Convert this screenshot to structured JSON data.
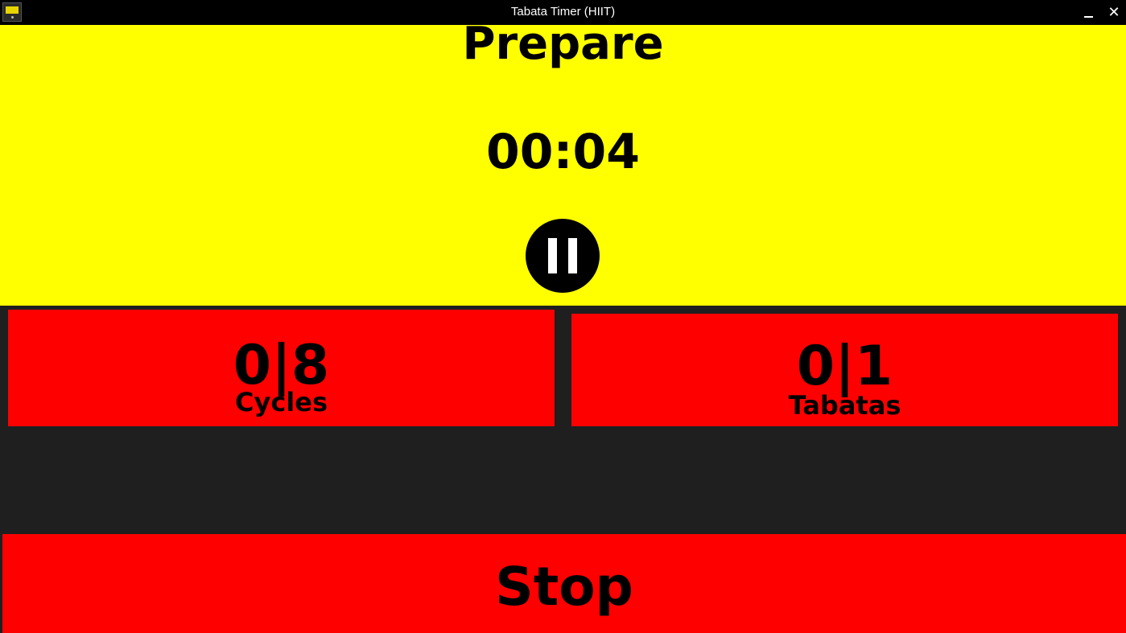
{
  "window": {
    "title": "Tabata Timer (HIIT)",
    "close_glyph": "✕"
  },
  "phase": {
    "label": "Prepare",
    "time": "00:04",
    "background_color": "#ffff00"
  },
  "controls": {
    "pause_icon": "pause-icon"
  },
  "counters": {
    "cycles": {
      "value": "0|8",
      "label": "Cycles"
    },
    "tabatas": {
      "value": "0|1",
      "label": "Tabatas"
    },
    "card_color": "#ff0000"
  },
  "stop": {
    "label": "Stop",
    "color": "#ff0000"
  }
}
